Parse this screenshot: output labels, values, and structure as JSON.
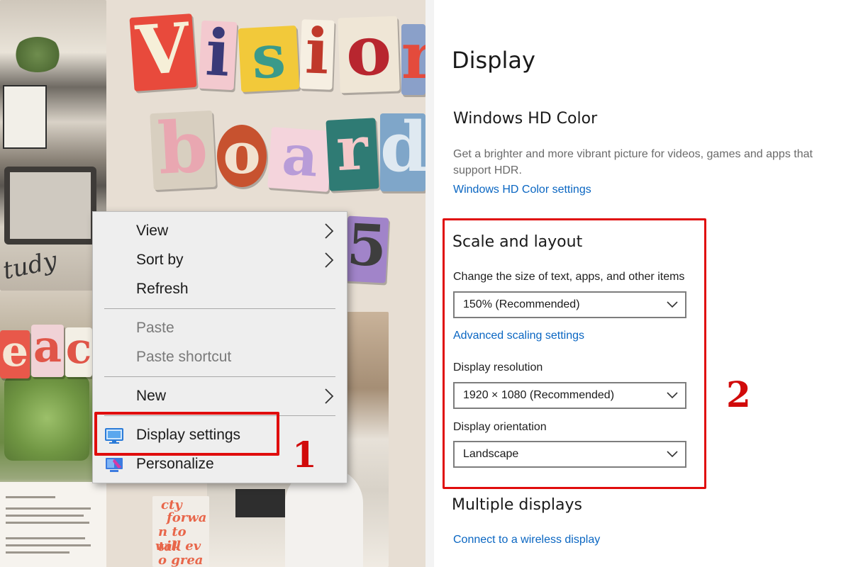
{
  "wallpaper": {
    "title_letters": [
      "V",
      "i",
      "s",
      "i",
      "o",
      "r"
    ],
    "subtitle_letters": [
      "b",
      "o",
      "a",
      "r",
      "d"
    ],
    "partial_word_letters": [
      "e",
      "a",
      "c"
    ],
    "year_fragment": "5",
    "handwriting": "tudy",
    "note_lines": [
      "cty",
      "forwa",
      "n to tak",
      "will ev",
      "o grea"
    ]
  },
  "context_menu": {
    "items": [
      {
        "label": "View",
        "has_submenu": true,
        "enabled": true
      },
      {
        "label": "Sort by",
        "has_submenu": true,
        "enabled": true
      },
      {
        "label": "Refresh",
        "has_submenu": false,
        "enabled": true
      },
      {
        "label": "Paste",
        "has_submenu": false,
        "enabled": false
      },
      {
        "label": "Paste shortcut",
        "has_submenu": false,
        "enabled": false
      },
      {
        "label": "New",
        "has_submenu": true,
        "enabled": true
      },
      {
        "label": "Display settings",
        "icon": "display-settings-icon",
        "enabled": true,
        "highlighted": true
      },
      {
        "label": "Personalize",
        "icon": "personalize-icon",
        "enabled": true
      }
    ]
  },
  "callouts": {
    "step1": "1",
    "step2": "2",
    "color": "#d10a0a"
  },
  "settings": {
    "page_title": "Display",
    "hdr": {
      "heading": "Windows HD Color",
      "description": "Get a brighter and more vibrant picture for videos, games and apps that support HDR.",
      "link": "Windows HD Color settings"
    },
    "scale": {
      "heading": "Scale and layout",
      "size_label": "Change the size of text, apps, and other items",
      "size_value": "150% (Recommended)",
      "advanced_link": "Advanced scaling settings",
      "resolution_label": "Display resolution",
      "resolution_value": "1920 × 1080 (Recommended)",
      "orientation_label": "Display orientation",
      "orientation_value": "Landscape"
    },
    "multiple": {
      "heading": "Multiple displays",
      "wireless_link": "Connect to a wireless display"
    },
    "link_color": "#0a66c2"
  }
}
